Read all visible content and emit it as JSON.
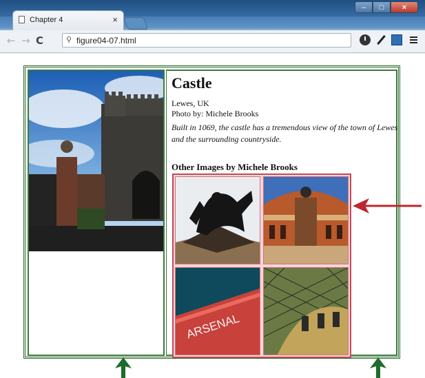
{
  "browser": {
    "tab_title": "Chapter 4",
    "tab_close": "×",
    "url": "figure04-07.html",
    "icons": {
      "back": "back-arrow-icon",
      "forward": "forward-arrow-icon",
      "reload": "reload-icon",
      "search": "search-icon",
      "clock": "clock-icon",
      "dropper": "eyedropper-icon",
      "screen": "screen-capture-icon",
      "menu": "menu-icon"
    },
    "window_controls": {
      "minimize": "–",
      "maximize": "□",
      "close": "×"
    }
  },
  "page": {
    "title": "Castle",
    "location": "Lewes, UK",
    "credit": "Photo by: Michele Brooks",
    "description": "Built in 1069, the castle has a tremendous view of the town of Lewes and the surrounding countryside.",
    "other_heading": "Other Images by Michele Brooks",
    "thumbnails": [
      {
        "subject": "statue"
      },
      {
        "subject": "concert-hall"
      },
      {
        "subject": "arsenal-stadium",
        "sign_text": "ARSENAL"
      },
      {
        "subject": "glass-roof"
      }
    ]
  },
  "annotations": {
    "red_arrow_color": "#c0262e",
    "green_arrow_color": "#1f6b2b"
  },
  "colors": {
    "layout_border": "#2c6a2c",
    "gallery_border": "#c24a55"
  }
}
